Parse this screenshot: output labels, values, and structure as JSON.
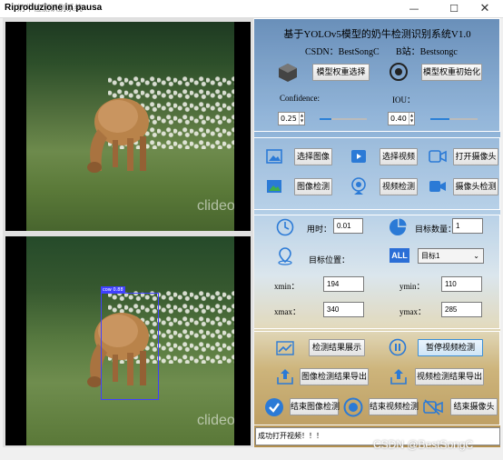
{
  "window": {
    "title": "奶牛检测识别系统",
    "overlay_title": "Riproduzione in pausa"
  },
  "video": {
    "watermark": "clideo.com",
    "detection_label": "cow 0.88"
  },
  "header": {
    "title": "基于YOLOv5模型的奶牛检测识别系统V1.0",
    "csdn": "CSDN：BestSongC",
    "bilibili": "B站：Bestsongc"
  },
  "model": {
    "select_weights": "模型权重选择",
    "init_weights": "模型权重初始化",
    "confidence_label": "Confidence:",
    "confidence_value": "0.25",
    "confidence_level": 0.25,
    "iou_label": "IOU：",
    "iou_value": "0.40",
    "iou_level": 0.4
  },
  "inputs": {
    "select_image": "选择图像",
    "select_video": "选择视频",
    "open_camera": "打开摄像头",
    "image_detect": "图像检测",
    "video_detect": "视频检测",
    "camera_detect": "摄像头检测"
  },
  "results": {
    "time_label": "用时：",
    "time_value": "0.01",
    "count_label": "目标数量：",
    "count_value": "1",
    "pos_label": "目标位置：",
    "target_select": "目标1",
    "xmin_label": "xmin：",
    "xmin": "194",
    "ymin_label": "ymin：",
    "ymin": "110",
    "xmax_label": "xmax：",
    "xmax": "340",
    "ymax_label": "ymax：",
    "ymax": "285"
  },
  "actions": {
    "show_results": "检测结果展示",
    "pause_video": "暂停视频检测",
    "export_image": "图像检测结果导出",
    "export_video": "视频检测结果导出",
    "end_image": "结束图像检测",
    "end_video": "结束视频检测",
    "end_camera": "结束摄像头"
  },
  "status": {
    "message": "成功打开视频！！！"
  },
  "footer": {
    "watermark": "CSDN @BestSongC"
  },
  "colors": {
    "icon_blue": "#2b7ad6",
    "bbox": "#4040ff"
  }
}
